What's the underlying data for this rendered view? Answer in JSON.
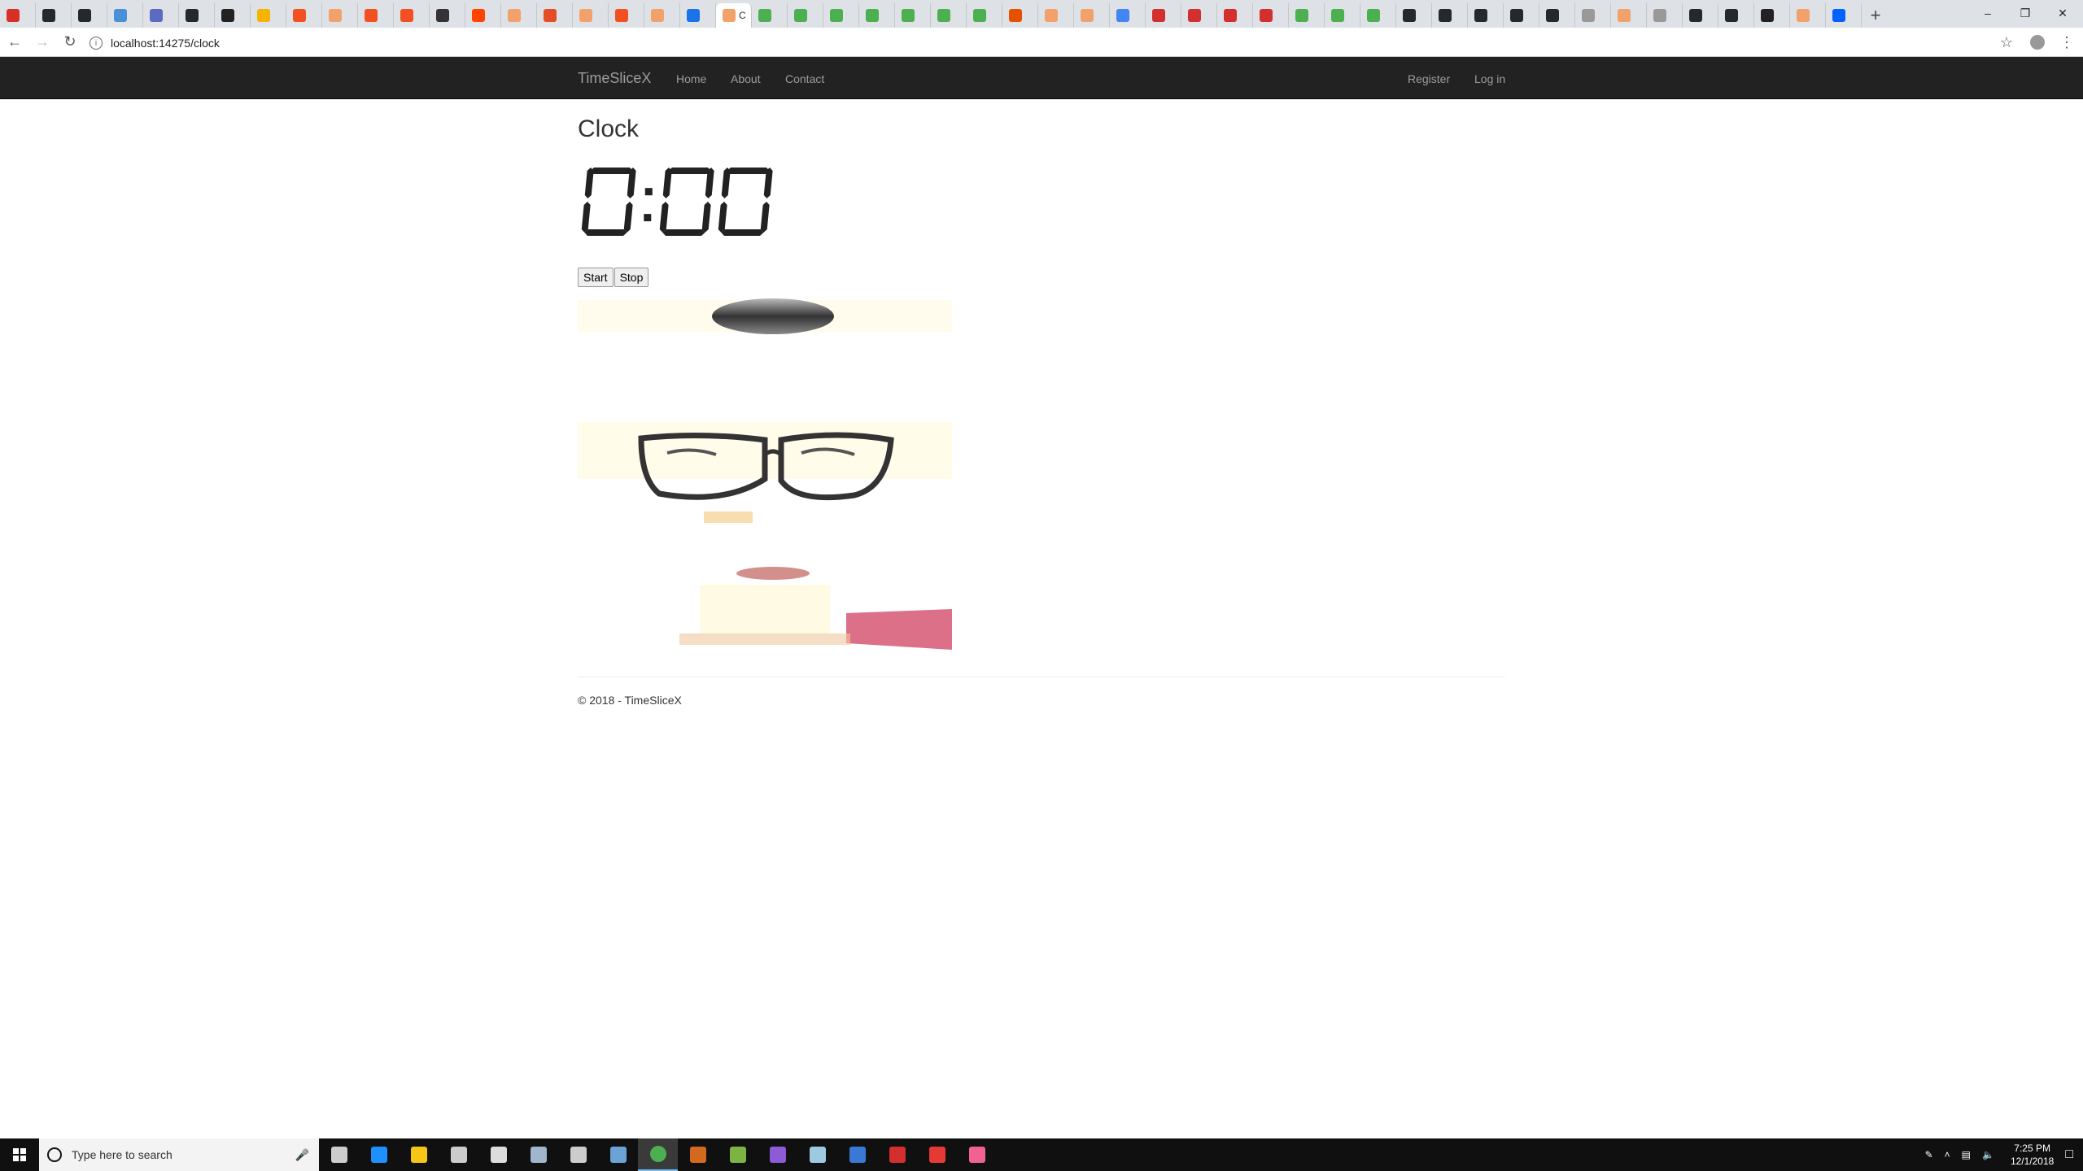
{
  "browser": {
    "active_tab_title": "C",
    "url": "localhost:14275/clock",
    "tab_colors": [
      "#d93025",
      "#24292e",
      "#24292e",
      "#4a90d9",
      "#5c6bc0",
      "#24292e",
      "#222",
      "#f4b400",
      "#f25022",
      "#f2a16b",
      "#f25022",
      "#f25022",
      "#333",
      "#ff4500",
      "#f2a16b",
      "#e44d26",
      "#f2a16b",
      "#f25022",
      "#f2a16b",
      "#1a73e8",
      "#f2a16b",
      "#4caf50",
      "#4caf50",
      "#4caf50",
      "#4caf50",
      "#4caf50",
      "#4caf50",
      "#4caf50",
      "#e65100",
      "#f2a16b",
      "#f2a16b",
      "#4285f4",
      "#d32f2f",
      "#d32f2f",
      "#d32f2f",
      "#d32f2f",
      "#4caf50",
      "#4caf50",
      "#4caf50",
      "#24292e",
      "#24292e",
      "#24292e",
      "#24292e",
      "#24292e",
      "#999",
      "#f2a16b",
      "#999",
      "#24292e",
      "#24292e",
      "#222",
      "#f2a16b",
      "#0061ff"
    ]
  },
  "site": {
    "brand": "TimeSliceX",
    "nav": [
      "Home",
      "About",
      "Contact"
    ],
    "nav_right": [
      "Register",
      "Log in"
    ],
    "accent": "#222222"
  },
  "page": {
    "title": "Clock",
    "clock_value": "0:00",
    "start_label": "Start",
    "stop_label": "Stop",
    "footer": "© 2018 - TimeSliceX"
  },
  "taskbar": {
    "search_placeholder": "Type here to search",
    "time": "7:25 PM",
    "date": "12/1/2018",
    "icons": [
      "task-view-icon",
      "edge-icon",
      "file-explorer-icon",
      "store-icon",
      "mail-icon",
      "app-icon",
      "terminal-icon",
      "app-icon",
      "chrome-icon",
      "app-icon",
      "app-icon",
      "visual-studio-icon",
      "app-icon",
      "powershell-icon",
      "app-icon",
      "app-icon",
      "maps-icon"
    ]
  }
}
